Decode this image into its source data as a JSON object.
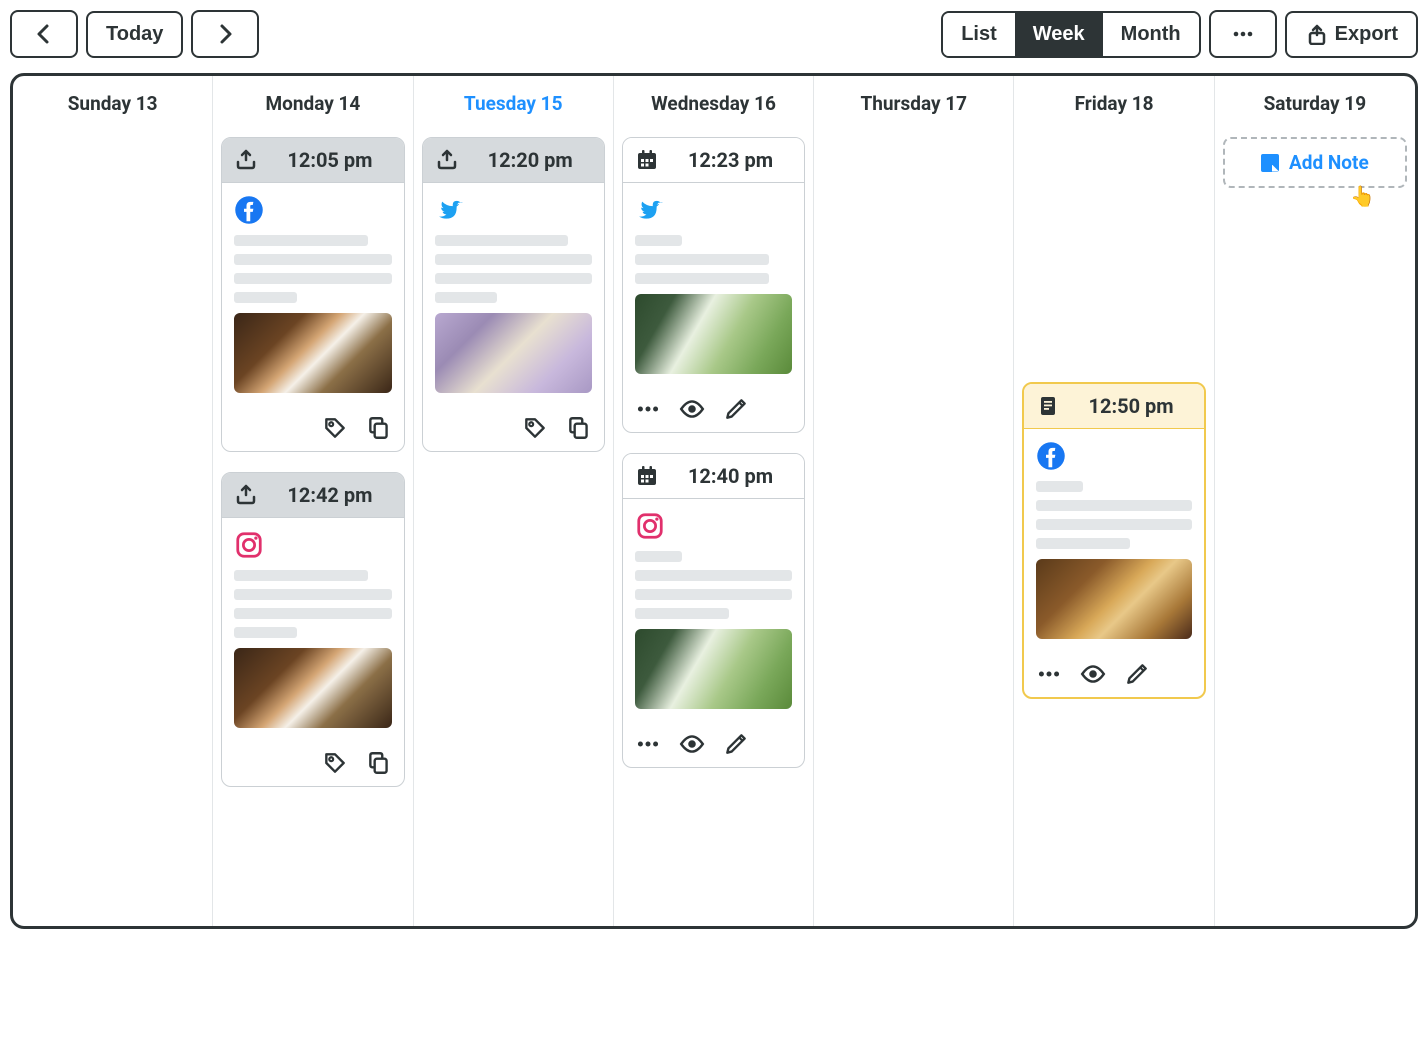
{
  "toolbar": {
    "today_label": "Today",
    "view": {
      "list": "List",
      "week": "Week",
      "month": "Month"
    },
    "more_label": "•••",
    "export_label": "Export"
  },
  "days": [
    {
      "label": "Sunday 13",
      "active": false
    },
    {
      "label": "Monday 14",
      "active": false
    },
    {
      "label": "Tuesday 15",
      "active": true
    },
    {
      "label": "Wednesday 16",
      "active": false
    },
    {
      "label": "Thursday 17",
      "active": false
    },
    {
      "label": "Friday 18",
      "active": false
    },
    {
      "label": "Saturday 19",
      "active": false
    }
  ],
  "cards": {
    "mon1": {
      "time": "12:05 pm",
      "status": "published",
      "network": "facebook",
      "image": "coffee",
      "actions": "tag-copy"
    },
    "mon2": {
      "time": "12:42 pm",
      "status": "published",
      "network": "instagram",
      "image": "coffee",
      "actions": "tag-copy"
    },
    "tue1": {
      "time": "12:20 pm",
      "status": "published",
      "network": "twitter",
      "image": "lilac",
      "actions": "tag-copy"
    },
    "wed1": {
      "time": "12:23 pm",
      "status": "scheduled",
      "network": "twitter",
      "image": "matcha",
      "actions": "more-eye-edit"
    },
    "wed2": {
      "time": "12:40 pm",
      "status": "scheduled",
      "network": "instagram",
      "image": "matcha",
      "actions": "more-eye-edit"
    },
    "fri1": {
      "time": "12:50 pm",
      "status": "draft",
      "network": "facebook",
      "image": "whiskey",
      "actions": "more-eye-edit"
    }
  },
  "add_note_label": "Add Note"
}
